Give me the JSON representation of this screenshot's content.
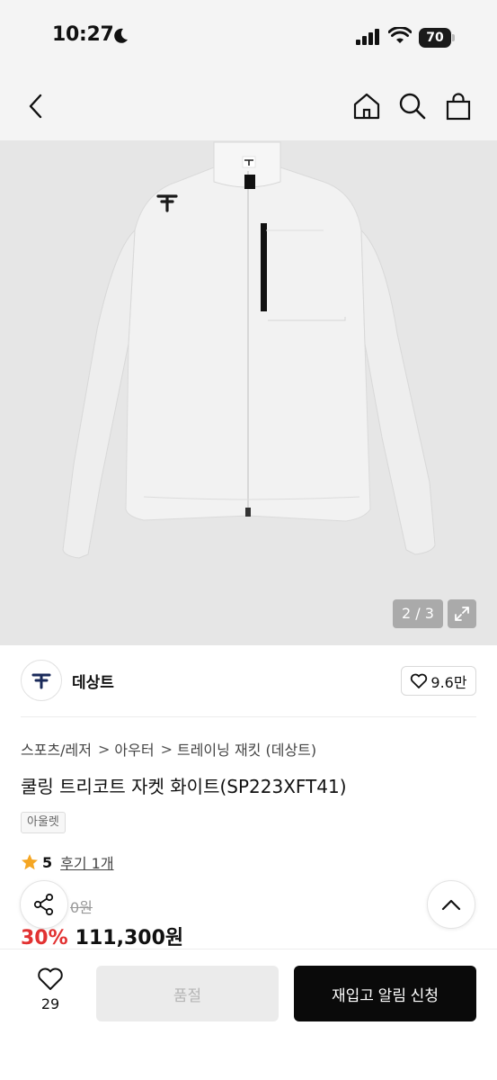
{
  "status_bar": {
    "time": "10:27",
    "battery": "70"
  },
  "gallery": {
    "counter": "2 / 3"
  },
  "brand": {
    "name": "데상트",
    "likes": "9.6만"
  },
  "breadcrumb": [
    "스포츠/레저",
    "아우터",
    "트레이닝 재킷 (데상트)"
  ],
  "breadcrumb_separator": ">",
  "product": {
    "title": "쿨링 트리코트 자켓 화이트(SP223XFT41)",
    "badge": "아울렛",
    "rating": "5",
    "review_link": "후기 1개",
    "original_price_visible": "0원",
    "discount": "30%",
    "sale_price": "111,300원"
  },
  "bottom_bar": {
    "wish_count": "29",
    "soldout_label": "품절",
    "restock_label": "재입고 알림 신청"
  },
  "colors": {
    "accent_red": "#e23232",
    "star": "#f5a623",
    "primary_button": "#0a0a0a"
  }
}
